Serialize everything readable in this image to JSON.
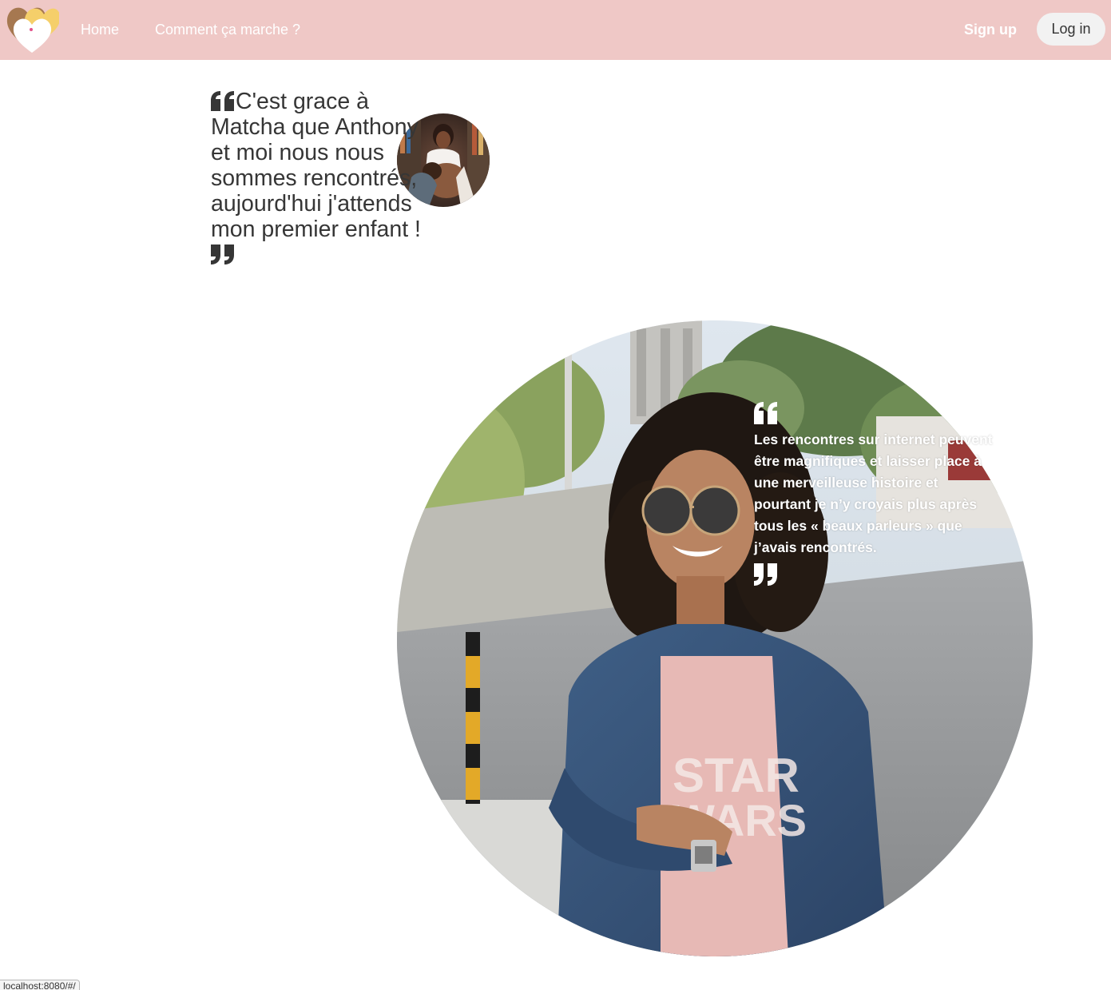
{
  "nav": {
    "home_label": "Home",
    "how_label": "Comment ça marche ?",
    "signup_label": "Sign up",
    "login_label": "Log in"
  },
  "testimonials": [
    {
      "text": "C'est grace à Matcha que Anthony et moi nous nous sommes rencontrés, aujourd'hui j'attends mon premier enfant !"
    },
    {
      "text": "Les rencontres sur internet peuvent être magnifiques et laisser place à une merveilleuse histoire et pourtant je n’y croyais plus après tous les « beaux parleurs » que j’avais rencontrés."
    }
  ],
  "status_bar": {
    "url": "localhost:8080/#/"
  },
  "icons": {
    "logo": "hearts-logo",
    "quote_open": "quote-left-icon",
    "quote_close": "quote-right-icon"
  },
  "colors": {
    "navbar": "#efc8c6",
    "login_button": "#f2f2f2",
    "heading_text": "#363636"
  }
}
